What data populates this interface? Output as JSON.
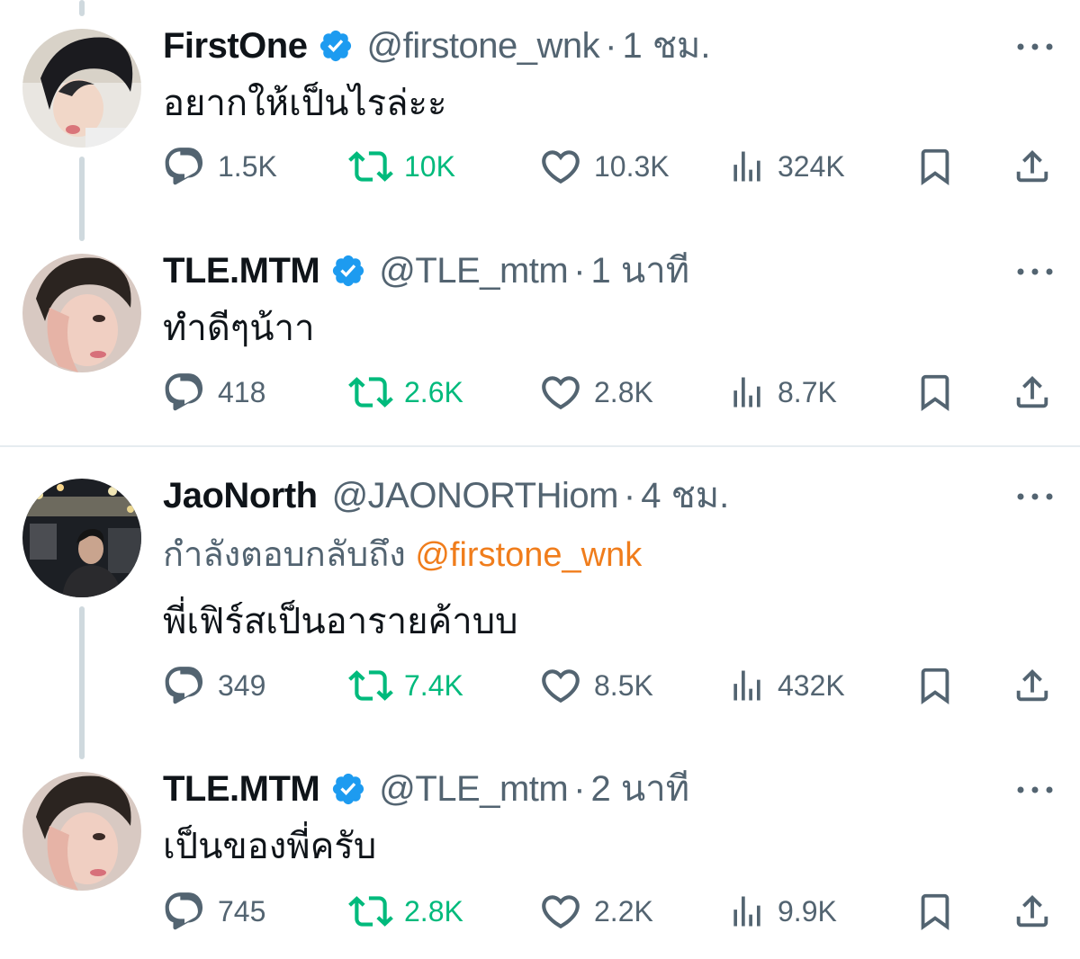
{
  "colors": {
    "verified": "#1d9bf0",
    "retweet": "#00ba7c",
    "muted_text": "#536471",
    "mention": "#f07d1c",
    "thread_line": "#cfd9de"
  },
  "tweets": [
    {
      "name": "FirstOne",
      "verified": true,
      "handle": "@firstone_wnk",
      "separator": "·",
      "time": "1 ชม.",
      "text": "อยากให้เป็นไรล่ะะ",
      "replies": "1.5K",
      "retweets": "10K",
      "likes": "10.3K",
      "views": "324K"
    },
    {
      "name": "TLE.MTM",
      "verified": true,
      "handle": "@TLE_mtm",
      "separator": "·",
      "time": "1 นาที",
      "text": "ทำดีๆน้าา",
      "replies": "418",
      "retweets": "2.6K",
      "likes": "2.8K",
      "views": "8.7K"
    },
    {
      "name": "JaoNorth",
      "verified": false,
      "handle": "@JAONORTHiom",
      "separator": "·",
      "time": "4 ชม.",
      "reply_prefix": "กำลังตอบกลับถึง",
      "reply_mention": "@firstone_wnk",
      "text": "พี่เฟิร์สเป็นอารายค้าบบ",
      "replies": "349",
      "retweets": "7.4K",
      "likes": "8.5K",
      "views": "432K"
    },
    {
      "name": "TLE.MTM",
      "verified": true,
      "handle": "@TLE_mtm",
      "separator": "·",
      "time": "2 นาที",
      "text": "เป็นของพี่ครับ",
      "replies": "745",
      "retweets": "2.8K",
      "likes": "2.2K",
      "views": "9.9K"
    }
  ],
  "icons": {
    "reply": "reply-icon",
    "retweet": "retweet-icon",
    "like": "heart-icon",
    "views": "views-icon",
    "bookmark": "bookmark-icon",
    "share": "share-icon",
    "more": "more-icon",
    "verified": "verified-badge-icon"
  }
}
